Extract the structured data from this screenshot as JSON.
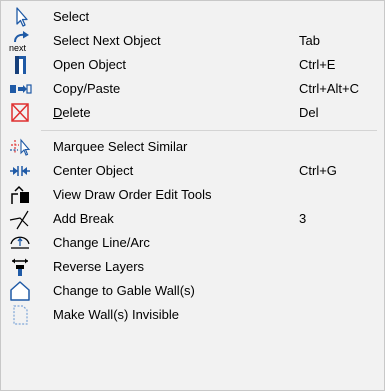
{
  "menu": {
    "items": [
      {
        "label": "Select",
        "shortcut": "",
        "icon": "select-arrow-icon"
      },
      {
        "label": "Select Next Object",
        "shortcut": "Tab",
        "icon": "next-icon",
        "icon_text": "next"
      },
      {
        "label": "Open Object",
        "shortcut": "Ctrl+E",
        "icon": "open-object-icon"
      },
      {
        "label": "Copy/Paste",
        "shortcut": "Ctrl+Alt+C",
        "icon": "copy-paste-icon"
      },
      {
        "label_pre": "",
        "label_u": "D",
        "label_post": "elete",
        "shortcut": "Del",
        "icon": "delete-icon"
      },
      {
        "label": "Marquee Select Similar",
        "shortcut": "",
        "icon": "marquee-select-icon"
      },
      {
        "label": "Center Object",
        "shortcut": "Ctrl+G",
        "icon": "center-object-icon"
      },
      {
        "label": "View Draw Order Edit Tools",
        "shortcut": "",
        "icon": "draw-order-icon"
      },
      {
        "label": "Add Break",
        "shortcut": "3",
        "icon": "add-break-icon"
      },
      {
        "label": "Change Line/Arc",
        "shortcut": "",
        "icon": "line-arc-icon"
      },
      {
        "label": "Reverse Layers",
        "shortcut": "",
        "icon": "reverse-layers-icon"
      },
      {
        "label": "Change to Gable Wall(s)",
        "shortcut": "",
        "icon": "gable-wall-icon"
      },
      {
        "label": "Make Wall(s) Invisible",
        "shortcut": "",
        "icon": "invisible-wall-icon"
      }
    ]
  },
  "colors": {
    "accent_blue": "#1f5aa6",
    "delete_red": "#e03030",
    "background": "#f2f2f2"
  }
}
